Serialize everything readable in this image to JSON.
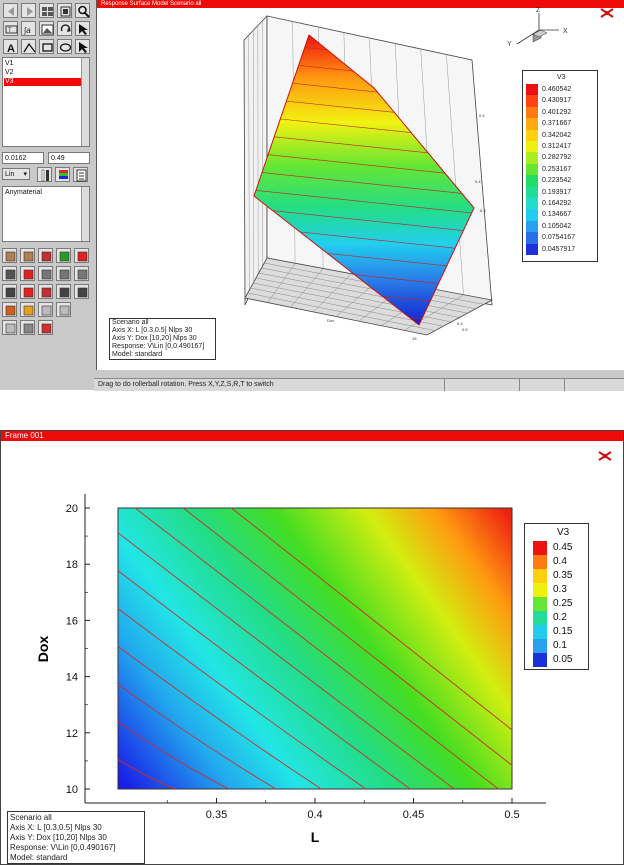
{
  "top_window": {
    "frame_title": "Response Surface Model Scenario all",
    "variables": [
      "V1",
      "V2",
      "V3"
    ],
    "selected_variable": "V3",
    "range_min": "0.0162",
    "range_max": "0.49",
    "scale_select": "Lin",
    "material": "Anymaterial",
    "axis_labels": {
      "x": "X",
      "y": "Y",
      "z": "Z"
    },
    "legend_title": "V3",
    "legend_levels": [
      "0.460542",
      "0.430917",
      "0.401292",
      "0.371667",
      "0.342042",
      "0.312417",
      "0.282792",
      "0.253167",
      "0.223542",
      "0.193917",
      "0.164292",
      "0.134667",
      "0.105042",
      "0.0754167",
      "0.0457917"
    ],
    "info": [
      "Scenario all",
      "Axis X: L [0.3,0.5] Nlps 30",
      "Axis Y: Dox [10,20] Nlps 30",
      "Response: V\\Lin [0,0.490167]",
      "Model: standard"
    ],
    "status": "Drag to do rollerball rotation.  Press X,Y,Z,S,R,T to switch"
  },
  "bottom_frame": {
    "frame_title": "Frame 001",
    "legend_title": "V3",
    "info": [
      "Scenario all",
      "Axis X: L [0.3,0.5] Nlps 30",
      "Axis Y: Dox [10,20] Nlps 30",
      "Response: V\\Lin [0,0.490167]",
      "Model: standard"
    ]
  },
  "chart_data": {
    "type": "heatmap",
    "xlabel": "L",
    "ylabel": "Dox",
    "xlim": [
      0.3,
      0.5
    ],
    "ylim": [
      10,
      20
    ],
    "x_ticks": [
      "0.35",
      "0.4",
      "0.45",
      "0.5"
    ],
    "y_ticks": [
      "10",
      "12",
      "14",
      "16",
      "18",
      "20"
    ],
    "colorbar_title": "V3",
    "colorbar_ticks": [
      "0.45",
      "0.4",
      "0.35",
      "0.3",
      "0.25",
      "0.2",
      "0.15",
      "0.1",
      "0.05"
    ],
    "value_range": [
      0.0162,
      0.49
    ],
    "grid": false,
    "legend_position": "right"
  },
  "colors": {
    "titlebar": "#ef0a0a",
    "panel": "#c9c9c9",
    "contour_line": "#d02020"
  }
}
